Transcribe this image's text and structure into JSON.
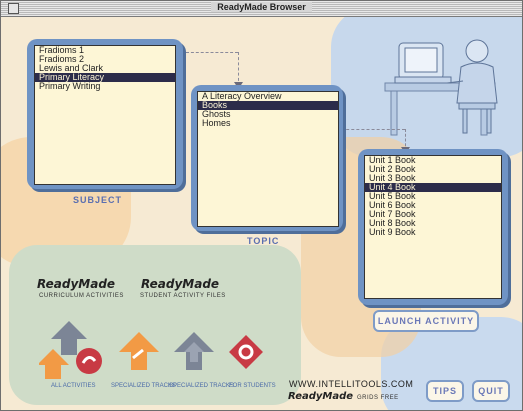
{
  "window": {
    "title": "ReadyMade Browser"
  },
  "subject": {
    "caption": "SUBJECT",
    "items": [
      "Fradioms 1",
      "Fradioms 2",
      "Lewis and Clark",
      "Primary Literacy",
      "Primary Writing"
    ],
    "selected_index": 3
  },
  "topic": {
    "caption": "TOPIC",
    "items": [
      "A Literacy Overview",
      "Books",
      "Ghosts",
      "Homes"
    ],
    "selected_index": 1
  },
  "units": {
    "items": [
      "Unit 1 Book",
      "Unit 2 Book",
      "Unit 3 Book",
      "Unit 4 Book",
      "Unit 5 Book",
      "Unit 6 Book",
      "Unit 7 Book",
      "Unit 8 Book",
      "Unit 9 Book"
    ],
    "selected_index": 3
  },
  "buttons": {
    "launch": "LAUNCH ACTIVITY",
    "tips": "TIPS",
    "quit": "QUIT"
  },
  "brands": {
    "left_name": "ReadyMade",
    "left_sub": "CURRICULUM ACTIVITIES",
    "right_name": "ReadyMade",
    "right_sub": "STUDENT ACTIVITY FILES"
  },
  "icons": {
    "label_1": "ALL ACTIVITIES",
    "label_2": "SPECIALIZED TRACKS",
    "label_3": "SPECIALIZED TRACKS",
    "label_4": "FOR STUDENTS"
  },
  "footer": {
    "url": "WWW.INTELLITOOLS.COM",
    "brand": "ReadyMade",
    "brand_suffix": "GRIDS FREE"
  },
  "colors": {
    "panel": "#6f93c4",
    "list_bg": "#fdf6d6",
    "selection": "#2c2c4a",
    "orange": "#f29a45",
    "red": "#c83a44",
    "gray": "#7c8596"
  }
}
